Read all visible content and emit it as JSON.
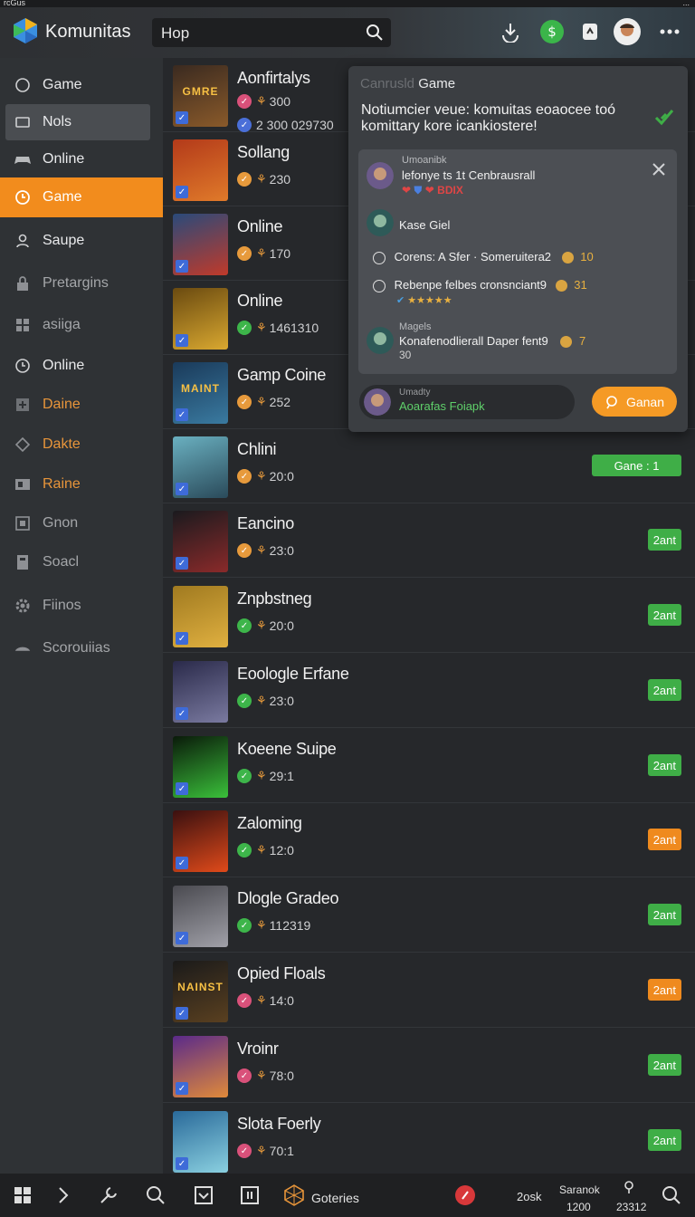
{
  "status": {
    "left": "rcGus",
    "right": "..."
  },
  "app": {
    "title": "Komunitas",
    "search_value": "Hop"
  },
  "sidebar": {
    "items": [
      {
        "label": "Game",
        "icon": "chat-icon",
        "state": "normal"
      },
      {
        "label": "Nols",
        "icon": "box-icon",
        "state": "selected"
      },
      {
        "label": "Online",
        "icon": "controller-icon",
        "state": "normal"
      },
      {
        "label": "Game",
        "icon": "clock-icon",
        "state": "active"
      },
      {
        "label": "Saupe",
        "icon": "user-icon",
        "state": "normal"
      },
      {
        "label": "Pretargins",
        "icon": "lock-icon",
        "state": "dim"
      },
      {
        "label": "asiiga",
        "icon": "grid-icon",
        "state": "dim"
      },
      {
        "label": "Online",
        "icon": "clock-icon",
        "state": "normal"
      },
      {
        "label": "Daine",
        "icon": "plus-box-icon",
        "state": "orange"
      },
      {
        "label": "Dakte",
        "icon": "tag-icon",
        "state": "orange"
      },
      {
        "label": "Raine",
        "icon": "layout-icon",
        "state": "orange"
      },
      {
        "label": "Gnon",
        "icon": "square-icon",
        "state": "dim"
      },
      {
        "label": "Soacl",
        "icon": "file-icon",
        "state": "dim"
      },
      {
        "label": "Fiinos",
        "icon": "gear-icon",
        "state": "dim"
      },
      {
        "label": "Scorouiias",
        "icon": "cloud-icon",
        "state": "dim"
      }
    ]
  },
  "games": [
    {
      "title": "Aonfirtalys",
      "stat": "300",
      "stat2": "2 300 029730",
      "dot": "#d9517a",
      "thumb": [
        "#3a2a20",
        "#8a5a2a"
      ],
      "thumb_text": "GMRE",
      "tag": ""
    },
    {
      "title": "Sollang",
      "stat": "230",
      "dot": "#e79a3c",
      "thumb": [
        "#b33a1a",
        "#e07a2a"
      ],
      "thumb_text": "",
      "tag": ""
    },
    {
      "title": "Online",
      "stat": "170",
      "dot": "#e79a3c",
      "thumb": [
        "#2a4a7a",
        "#c03a2a"
      ],
      "thumb_text": "",
      "tag": ""
    },
    {
      "title": "Online",
      "stat": "1461310",
      "dot": "#3db54a",
      "thumb": [
        "#6a4a10",
        "#d9a830"
      ],
      "thumb_text": "",
      "tag": ""
    },
    {
      "title": "Gamp Coine",
      "stat": "252",
      "dot": "#e79a3c",
      "thumb": [
        "#1a3a5a",
        "#3a7aa0"
      ],
      "thumb_text": "MAINT",
      "tag": ""
    },
    {
      "title": "Chlini",
      "stat": "20:0",
      "dot": "#e79a3c",
      "thumb": [
        "#6ab0c0",
        "#2a4a5a"
      ],
      "thumb_text": "",
      "tag": "Gane : 1",
      "tag_color": "#3fae47"
    },
    {
      "title": "Eancino",
      "stat": "23:0",
      "dot": "#e79a3c",
      "thumb": [
        "#1a1a1e",
        "#8a2a2a"
      ],
      "thumb_text": "",
      "tag": "2ant",
      "tag_color": "#3fae47"
    },
    {
      "title": "Znpbstneg",
      "stat": "20:0",
      "dot": "#3db54a",
      "thumb": [
        "#a07a20",
        "#e0b040"
      ],
      "thumb_text": "",
      "tag": "2ant",
      "tag_color": "#3fae47"
    },
    {
      "title": "Eoologle Erfane",
      "stat": "23:0",
      "dot": "#3db54a",
      "thumb": [
        "#2a2a4a",
        "#7a7aa0"
      ],
      "thumb_text": "",
      "tag": "2ant",
      "tag_color": "#3fae47"
    },
    {
      "title": "Koeene Suipe",
      "stat": "29:1",
      "dot": "#3db54a",
      "thumb": [
        "#0a1a0a",
        "#3ac03a"
      ],
      "thumb_text": "",
      "tag": "2ant",
      "tag_color": "#3fae47"
    },
    {
      "title": "Zaloming",
      "stat": "12:0",
      "dot": "#3db54a",
      "thumb": [
        "#3a1010",
        "#e04a1a"
      ],
      "thumb_text": "",
      "tag": "2ant",
      "tag_color": "#ef8a1e"
    },
    {
      "title": "Dlogle Gradeo",
      "stat": "112319",
      "dot": "#3db54a",
      "thumb": [
        "#4a4a50",
        "#a0a0a8"
      ],
      "thumb_text": "",
      "tag": "2ant",
      "tag_color": "#3fae47"
    },
    {
      "title": "Opied Floals",
      "stat": "14:0",
      "dot": "#d9517a",
      "thumb": [
        "#1a1a1a",
        "#5a4020"
      ],
      "thumb_text": "NAINST",
      "tag": "2ant",
      "tag_color": "#ef8a1e"
    },
    {
      "title": "Vroinr",
      "stat": "78:0",
      "dot": "#d9517a",
      "thumb": [
        "#5a2a8a",
        "#e08a3a"
      ],
      "thumb_text": "",
      "tag": "2ant",
      "tag_color": "#3fae47"
    },
    {
      "title": "Slota Foerly",
      "stat": "70:1",
      "dot": "#d9517a",
      "thumb": [
        "#2a6a9a",
        "#8ad0e0"
      ],
      "thumb_text": "",
      "tag": "2ant",
      "tag_color": "#3fae47"
    }
  ],
  "popup": {
    "title_dim": "Canrusld",
    "title": "Game",
    "message": "Notiumcier veue: komuitas eoaocee toó komittary kore icankiostere!",
    "user1_name": "Umoanibk",
    "user1_text": "lefonye ts 1t Cenbrausrall",
    "user1_badge": "BDIX",
    "user2_text": "Kase Giel",
    "line1_text": "Corens: A Sfer · Someruitera2",
    "line1_value": "10",
    "line2_text": "Rebenpe felbes cronsnciant9",
    "line2_value": "31",
    "user3_name": "Magels",
    "user3_text": "Konafenodlierall Daper fent9",
    "user3_value": "7",
    "user3_sub": "30",
    "foot_name": "Umadty",
    "foot_text": "Aoarafas Foiapk",
    "button": "Ganan"
  },
  "bottombar": {
    "categories": "Goteries",
    "stat_a": "2osk",
    "stat_b_label": "Saranok",
    "stat_b_value": "1200",
    "stat_c_value": "23312"
  }
}
